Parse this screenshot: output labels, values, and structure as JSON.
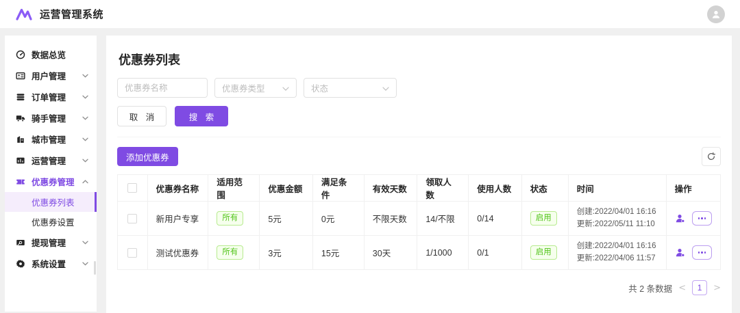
{
  "colors": {
    "accent": "#7f4be3",
    "success": "#52c41a",
    "active_bg": "#f5edfc"
  },
  "header": {
    "title": "运营管理系统"
  },
  "sidebar": {
    "items": [
      {
        "label": "数据总览",
        "icon": "dashboard-icon",
        "expandable": false
      },
      {
        "label": "用户管理",
        "icon": "id-card-icon",
        "expandable": true
      },
      {
        "label": "订单管理",
        "icon": "order-list-icon",
        "expandable": true
      },
      {
        "label": "骑手管理",
        "icon": "truck-icon",
        "expandable": true
      },
      {
        "label": "城市管理",
        "icon": "building-icon",
        "expandable": true
      },
      {
        "label": "运营管理",
        "icon": "operations-icon",
        "expandable": true
      },
      {
        "label": "优惠券管理",
        "icon": "ticket-icon",
        "expandable": true,
        "expanded": true,
        "active": true,
        "children": [
          {
            "label": "优惠券列表",
            "active": true
          },
          {
            "label": "优惠券设置",
            "active": false
          }
        ]
      },
      {
        "label": "提现管理",
        "icon": "withdraw-icon",
        "expandable": true
      },
      {
        "label": "系统设置",
        "icon": "gear-icon",
        "expandable": true
      }
    ]
  },
  "main": {
    "page_title": "优惠券列表",
    "filters": {
      "name_placeholder": "优惠券名称",
      "type_placeholder": "优惠券类型",
      "status_placeholder": "状态"
    },
    "buttons": {
      "cancel": "取 消",
      "search": "搜 索",
      "add": "添加优惠券"
    },
    "table": {
      "headers": [
        "优惠券名称",
        "适用范围",
        "优惠金额",
        "满足条件",
        "有效天数",
        "领取人数",
        "使用人数",
        "状态",
        "时间",
        "操作"
      ],
      "rows": [
        {
          "name": "新用户专享",
          "scope": "所有",
          "amount": "5元",
          "condition": "0元",
          "valid_days": "不限天数",
          "received": "14/不限",
          "used": "0/14",
          "status": "启用",
          "created": "创建:2022/04/01 16:16",
          "updated": "更新:2022/05/11 11:10"
        },
        {
          "name": "测试优惠券",
          "scope": "所有",
          "amount": "3元",
          "condition": "15元",
          "valid_days": "30天",
          "received": "1/1000",
          "used": "0/1",
          "status": "启用",
          "created": "创建:2022/04/01 16:16",
          "updated": "更新:2022/04/06 11:57"
        }
      ]
    },
    "pagination": {
      "total_text": "共 2 条数据",
      "prev": "<",
      "page": "1",
      "next": ">"
    }
  }
}
